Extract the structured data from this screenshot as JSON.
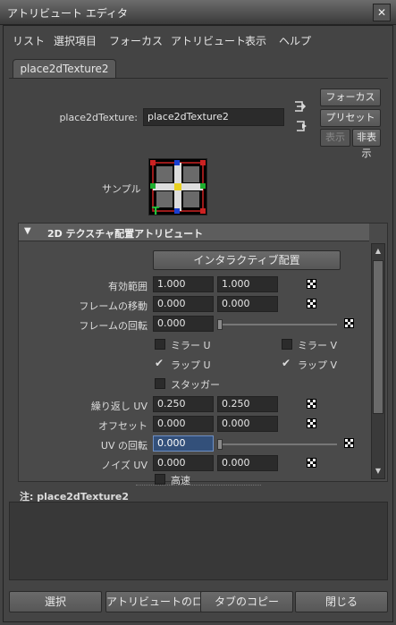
{
  "window": {
    "title": "アトリビュート エディタ",
    "close_glyph": "✕"
  },
  "menu": {
    "items": [
      "リスト",
      "選択項目",
      "フォーカス",
      "アトリビュート",
      "表示",
      "ヘルプ"
    ]
  },
  "tab": {
    "label": "place2dTexture2"
  },
  "node": {
    "label": "place2dTexture:",
    "value": "place2dTexture2"
  },
  "side_buttons": {
    "focus": "フォーカス",
    "preset": "プリセット",
    "show": "表示",
    "hide": "非表示"
  },
  "sample": {
    "label": "サンプル",
    "marker": "T"
  },
  "section": {
    "arrow": "▼",
    "title": "2D テクスチャ配置アトリビュート"
  },
  "interactive_button": "インタラクティブ配置",
  "rows": {
    "coverage": {
      "label": "有効範囲",
      "u": "1.000",
      "v": "1.000"
    },
    "translate_frame": {
      "label": "フレームの移動",
      "u": "0.000",
      "v": "0.000"
    },
    "rotate_frame": {
      "label": "フレームの回転",
      "value": "0.000"
    },
    "mirror_u": {
      "label": "ミラー U",
      "checked": false
    },
    "mirror_v": {
      "label": "ミラー V",
      "checked": false
    },
    "wrap_u": {
      "label": "ラップ U",
      "checked": true
    },
    "wrap_v": {
      "label": "ラップ V",
      "checked": true
    },
    "stagger": {
      "label": "スタッガー",
      "checked": false
    },
    "repeat_uv": {
      "label": "繰り返し UV",
      "u": "0.250",
      "v": "0.250"
    },
    "offset": {
      "label": "オフセット",
      "u": "0.000",
      "v": "0.000"
    },
    "rotate_uv": {
      "label": "UV の回転",
      "value": "0.000"
    },
    "noise_uv": {
      "label": "ノイズ UV",
      "u": "0.000",
      "v": "0.000"
    },
    "fast": {
      "label": "高速",
      "checked": false
    }
  },
  "check_glyph": "✔",
  "scroll": {
    "up": "▲",
    "down": "▼"
  },
  "notes": {
    "label": "注:  place2dTexture2"
  },
  "bottom_buttons": {
    "select": "選択",
    "load": "アトリビュートのロード",
    "copy": "タブのコピー",
    "close": "閉じる"
  },
  "colors": {
    "accent_field": "#33507a",
    "panel_bg": "#444444"
  }
}
